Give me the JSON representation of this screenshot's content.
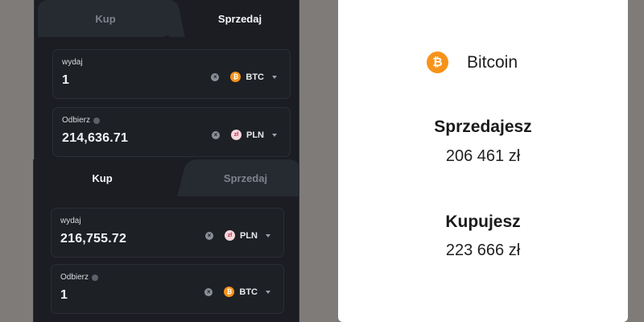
{
  "widget_sell": {
    "tab_buy": "Kup",
    "tab_sell": "Sprzedaj",
    "spend": {
      "label": "wydaj",
      "value": "1",
      "currency": "BTC",
      "coin_symbol": "₿"
    },
    "receive": {
      "label": "Odbierz",
      "value": "214,636.71",
      "currency": "PLN",
      "coin_symbol": "zł"
    }
  },
  "widget_buy": {
    "tab_buy": "Kup",
    "tab_sell": "Sprzedaj",
    "spend": {
      "label": "wydaj",
      "value": "216,755.72",
      "currency": "PLN",
      "coin_symbol": "zł"
    },
    "receive": {
      "label": "Odbierz",
      "value": "1",
      "currency": "BTC",
      "coin_symbol": "₿"
    }
  },
  "card": {
    "coin_name": "Bitcoin",
    "coin_symbol": "₿",
    "sell_title": "Sprzedajesz",
    "sell_price": "206 461 zł",
    "buy_title": "Kupujesz",
    "buy_price": "223 666 zł"
  },
  "colors": {
    "btc_orange": "#f7931a",
    "pln_pink": "#f3d7dc",
    "panel_bg": "#1b1d22",
    "inactive_tab": "#262a31"
  }
}
